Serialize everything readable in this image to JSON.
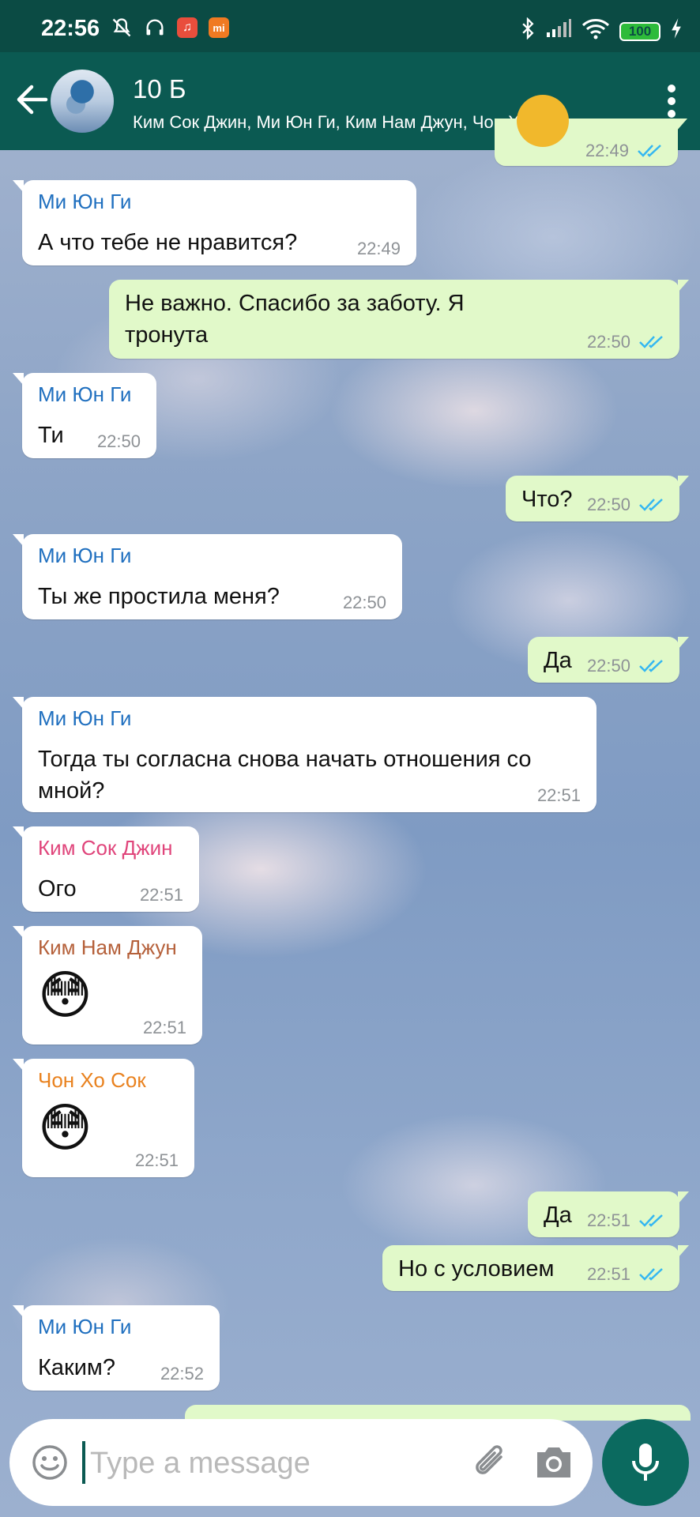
{
  "status_bar": {
    "time": "22:56",
    "battery": "100"
  },
  "header": {
    "title": "10 Б",
    "subtitle": "Ким Сок Джин, Ми Юн Ги, Ким Нам Джун, Чон Хо С.."
  },
  "top_partial_message": {
    "time": "22:49"
  },
  "messages": [
    {
      "dir": "in",
      "sender": "Ми Юн Ги",
      "sender_color": "#1f6fbf",
      "text": "А что тебе не нравится?",
      "time": "22:49"
    },
    {
      "dir": "out",
      "text": "Не важно. Спасибо за заботу. Я тронута",
      "time": "22:50"
    },
    {
      "dir": "in",
      "sender": "Ми Юн Ги",
      "sender_color": "#1f6fbf",
      "text": "Ти",
      "time": "22:50"
    },
    {
      "dir": "out",
      "text": "Что?",
      "time": "22:50"
    },
    {
      "dir": "in",
      "sender": "Ми Юн Ги",
      "sender_color": "#1f6fbf",
      "text": "Ты же простила меня?",
      "time": "22:50"
    },
    {
      "dir": "out",
      "text": "Да",
      "time": "22:50"
    },
    {
      "dir": "in",
      "sender": "Ми Юн Ги",
      "sender_color": "#1f6fbf",
      "text": "Тогда ты согласна снова начать отношения со мной?",
      "time": "22:51"
    },
    {
      "dir": "in",
      "sender": "Ким Сок Джин",
      "sender_color": "#e0457b",
      "text": "Ого",
      "time": "22:51"
    },
    {
      "dir": "in",
      "sender": "Ким Нам Джун",
      "sender_color": "#b5603a",
      "text": "😳",
      "time": "22:51"
    },
    {
      "dir": "in",
      "sender": "Чон Хо Сок",
      "sender_color": "#e9821f",
      "text": "😳",
      "time": "22:51"
    },
    {
      "dir": "out",
      "text": "Да",
      "time": "22:51"
    },
    {
      "dir": "out",
      "text": "Но с условием",
      "time": "22:51"
    },
    {
      "dir": "in",
      "sender": "Ми Юн Ги",
      "sender_color": "#1f6fbf",
      "text": "Каким?",
      "time": "22:52"
    }
  ],
  "input": {
    "placeholder": "Type a message",
    "value": ""
  },
  "colors": {
    "header_bg": "#0b5a52",
    "status_bg": "#0b4b44",
    "incoming_bubble": "#ffffff",
    "outgoing_bubble": "#e1f9c9",
    "read_ticks": "#34b7f1",
    "fab": "#0b6a5f"
  },
  "icons": {
    "back": "arrow-left-icon",
    "menu": "more-vertical-icon",
    "emoji": "smiley-icon",
    "attach": "paperclip-icon",
    "camera": "camera-icon",
    "mic": "microphone-icon",
    "read": "double-check-icon"
  }
}
